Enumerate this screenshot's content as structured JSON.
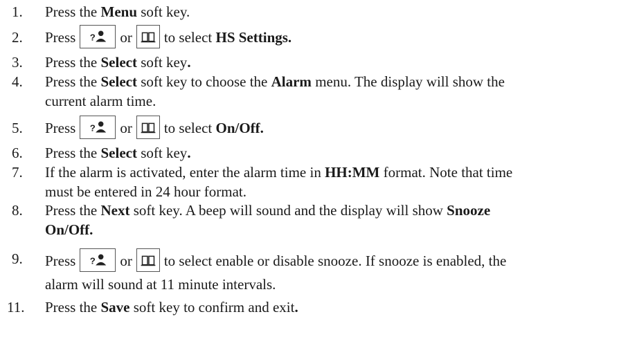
{
  "steps": [
    {
      "num": "1.",
      "parts": [
        "Press the ",
        "Menu",
        " soft key."
      ]
    },
    {
      "num": "2.",
      "press": "Press",
      "or": "or",
      "tail_pre": "to select ",
      "tail_bold": "HS Settings."
    },
    {
      "num": "3.",
      "parts": [
        "Press the ",
        "Select",
        " soft key",
        "."
      ]
    },
    {
      "num": "4.",
      "parts": [
        "Press the ",
        "Select",
        " soft key to choose the ",
        "Alarm",
        " menu.  The display will show the"
      ],
      "line2": "current alarm time."
    },
    {
      "num": "5.",
      "press": "Press",
      "or": "or",
      "tail_pre": "to select ",
      "tail_bold": "On/Off."
    },
    {
      "num": "6.",
      "parts": [
        "Press the ",
        "Select",
        " soft key",
        "."
      ]
    },
    {
      "num": "7.",
      "parts": [
        "If the alarm is activated, enter the alarm time in ",
        "HH:MM",
        " format.  Note that time"
      ],
      "line2": "must be entered in 24 hour format."
    },
    {
      "num": "8.",
      "parts": [
        "Press the ",
        "Next",
        " soft key.   A beep will sound and the display will show ",
        "Snooze"
      ],
      "line2_bold": "On/Off."
    },
    {
      "num": "9.",
      "press": "Press",
      "or": "or",
      "tail_pre": "to select enable or disable snooze.  If snooze is enabled, the",
      "line2": "alarm will sound at 11 minute intervals."
    },
    {
      "num": "11.",
      "parts": [
        "Press the ",
        "Save",
        " soft key to confirm and exit",
        "."
      ]
    }
  ],
  "icons": {
    "redial": "redial-key-icon",
    "book": "phonebook-key-icon"
  }
}
